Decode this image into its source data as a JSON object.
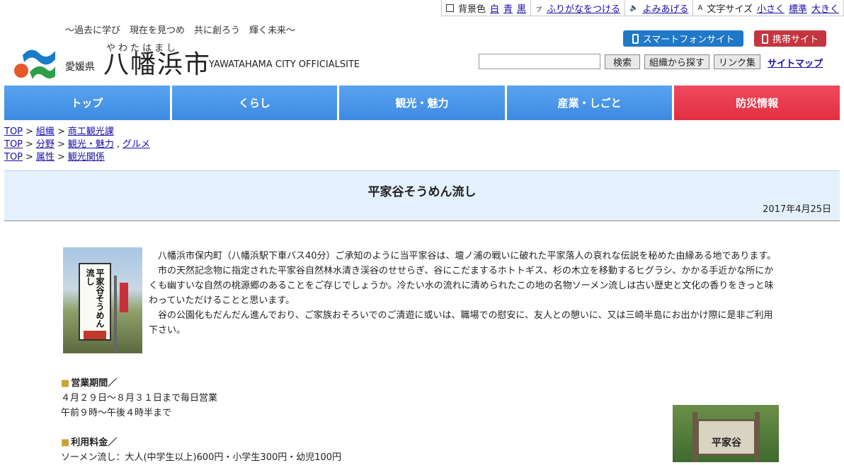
{
  "utility": {
    "bg_label": "背景色",
    "bg_white": "白",
    "bg_blue": "青",
    "bg_black": "黒",
    "furigana": "ふりがなをつける",
    "readaloud": "よみあげる",
    "fontsize_label": "文字サイズ",
    "font_small": "小さく",
    "font_normal": "標準",
    "font_large": "大きく"
  },
  "header": {
    "tagline": "〜過去に学び　現在を見つめ　共に創ろう　輝く未来〜",
    "prefecture": "愛媛県",
    "ruby": "やわたはまし",
    "city": "八幡浜市",
    "official": "YAWATAHAMA CITY OFFICIALSITE",
    "smartphone": "スマートフォンサイト",
    "mobile": "携帯サイト",
    "search_button": "検索",
    "org_button": "組織から探す",
    "links_button": "リンク集",
    "sitemap": "サイトマップ"
  },
  "nav": [
    "トップ",
    "くらし",
    "観光・魅力",
    "産業・しごと",
    "防災情報"
  ],
  "breadcrumbs": [
    [
      "TOP",
      "組織",
      "商工観光課"
    ],
    [
      "TOP",
      "分野",
      "観光・魅力",
      "グルメ"
    ],
    [
      "TOP",
      "属性",
      "観光関係"
    ]
  ],
  "page": {
    "title": "平家谷そうめん流し",
    "date": "2017年4月25日",
    "paragraphs": [
      "八幡浜市保内町（八幡浜駅下車バス40分）ご承知のように当平家谷は、壇ノ浦の戦いに破れた平家落人の哀れな伝説を秘めた由縁ある地であります。",
      "市の天然記念物に指定された平家谷自然林水清き渓谷のせせらぎ、谷にこだまするホトトギス、杉の木立を移動するヒグラシ、かかる手近かな所にかくも幽すいな自然の桃源郷のあることをご存じでしょうか。冷たい水の流れに清められたこの地の名物ソーメン流しは古い歴史と文化の香りをきっと味わっていただけることと思います。",
      "谷の公園化もだんだん進んでおり、ご家族おそろいでのご清遊に或いは、職場での慰安に、友人との憩いに、又は三崎半島にお出かけ際に是非ご利用下さい。"
    ],
    "sign_text": "平家谷そうめん流し",
    "hours_head": "営業期間／",
    "hours_line1": "４月２９日〜８月３１日まで毎日営業",
    "hours_line2": "午前９時〜午後４時半まで",
    "fee_head": "利用料金／",
    "fee_line1": "ソーメン流し：大人(中学生以上)600円・小学生300円・幼児100円",
    "board_text": "平家谷"
  }
}
